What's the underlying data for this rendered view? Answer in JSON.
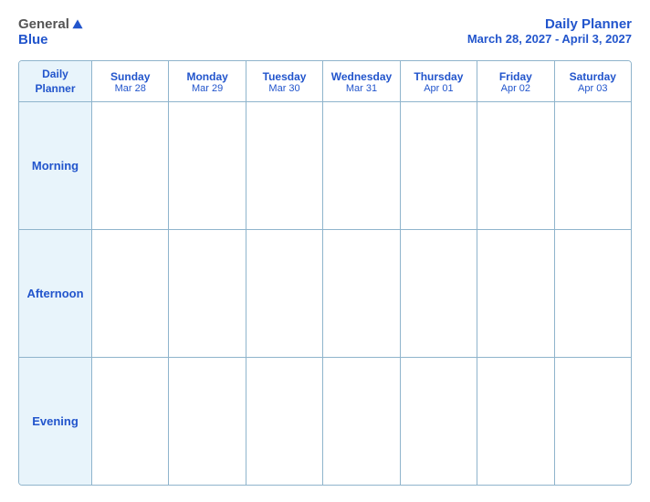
{
  "logo": {
    "general": "General",
    "blue": "Blue"
  },
  "title": {
    "main": "Daily Planner",
    "date_range": "March 28, 2027 - April 3, 2027"
  },
  "header": {
    "label_line1": "Daily",
    "label_line2": "Planner",
    "days": [
      {
        "name": "Sunday",
        "date": "Mar 28"
      },
      {
        "name": "Monday",
        "date": "Mar 29"
      },
      {
        "name": "Tuesday",
        "date": "Mar 30"
      },
      {
        "name": "Wednesday",
        "date": "Mar 31"
      },
      {
        "name": "Thursday",
        "date": "Apr 01"
      },
      {
        "name": "Friday",
        "date": "Apr 02"
      },
      {
        "name": "Saturday",
        "date": "Apr 03"
      }
    ]
  },
  "rows": [
    {
      "label": "Morning"
    },
    {
      "label": "Afternoon"
    },
    {
      "label": "Evening"
    }
  ]
}
